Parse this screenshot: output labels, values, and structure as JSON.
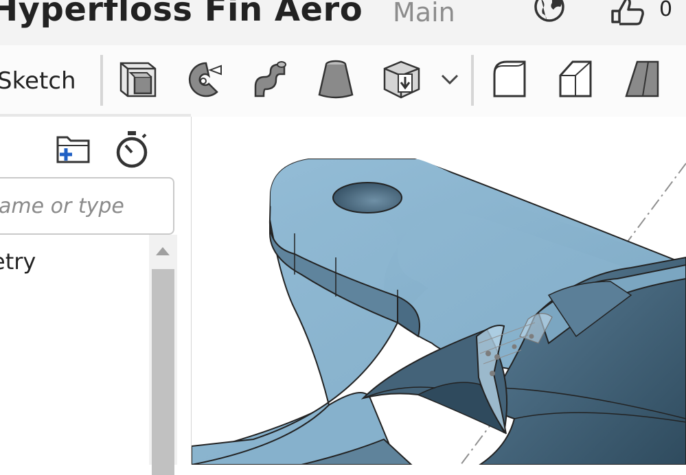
{
  "document": {
    "title": "Hyperfloss Fin Aero",
    "branch": "Main",
    "like_count": "0"
  },
  "toolbar": {
    "sketch_label": "Sketch",
    "tools": [
      {
        "name": "extrude-icon"
      },
      {
        "name": "revolve-icon"
      },
      {
        "name": "sweep-icon"
      },
      {
        "name": "loft-icon"
      },
      {
        "name": "thicken-icon"
      },
      {
        "name": "fillet-icon"
      },
      {
        "name": "chamfer-icon"
      },
      {
        "name": "draft-icon"
      }
    ]
  },
  "feature_panel": {
    "search_placeholder": "ame or type",
    "items": [
      {
        "label": "etry"
      }
    ]
  },
  "colors": {
    "part_face": "#8db7d2",
    "part_side": "#5b7f98",
    "part_dark": "#3d5b70",
    "accent_blue": "#1f5fc4"
  }
}
